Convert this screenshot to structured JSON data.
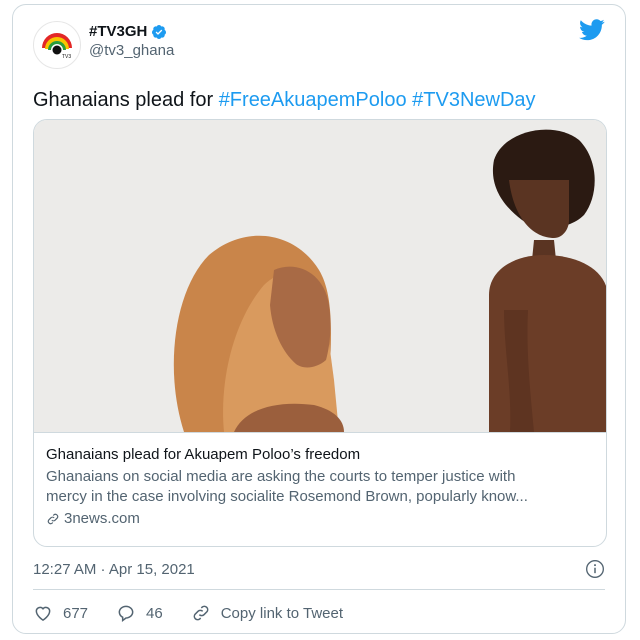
{
  "account": {
    "display_name": "#TV3GH",
    "handle": "@tv3_ghana",
    "avatar_icon": "tv3-logo",
    "verified_icon": "verified-badge-icon",
    "brand_icon": "twitter-bird-icon"
  },
  "tweet": {
    "text_prefix": "Ghanaians plead for ",
    "hashtag1": "#FreeAkuapemPoloo",
    "hashtag2": "#TV3NewDay"
  },
  "link_card": {
    "title": "Ghanaians plead for Akuapem Poloo’s freedom",
    "description_line1": "Ghanaians on social media are asking the courts to temper justice with",
    "description_line2": "mercy in the case involving socialite Rosemond Brown, popularly know...",
    "domain": "3news.com"
  },
  "meta": {
    "timestamp": "12:27 AM · Apr 15, 2021"
  },
  "actions": {
    "likes": "677",
    "replies": "46",
    "copy_link": "Copy link to Tweet"
  },
  "colors": {
    "accent": "#1d9bf0",
    "text": "#0f1419",
    "muted": "#536471",
    "border": "#cfd9de"
  }
}
